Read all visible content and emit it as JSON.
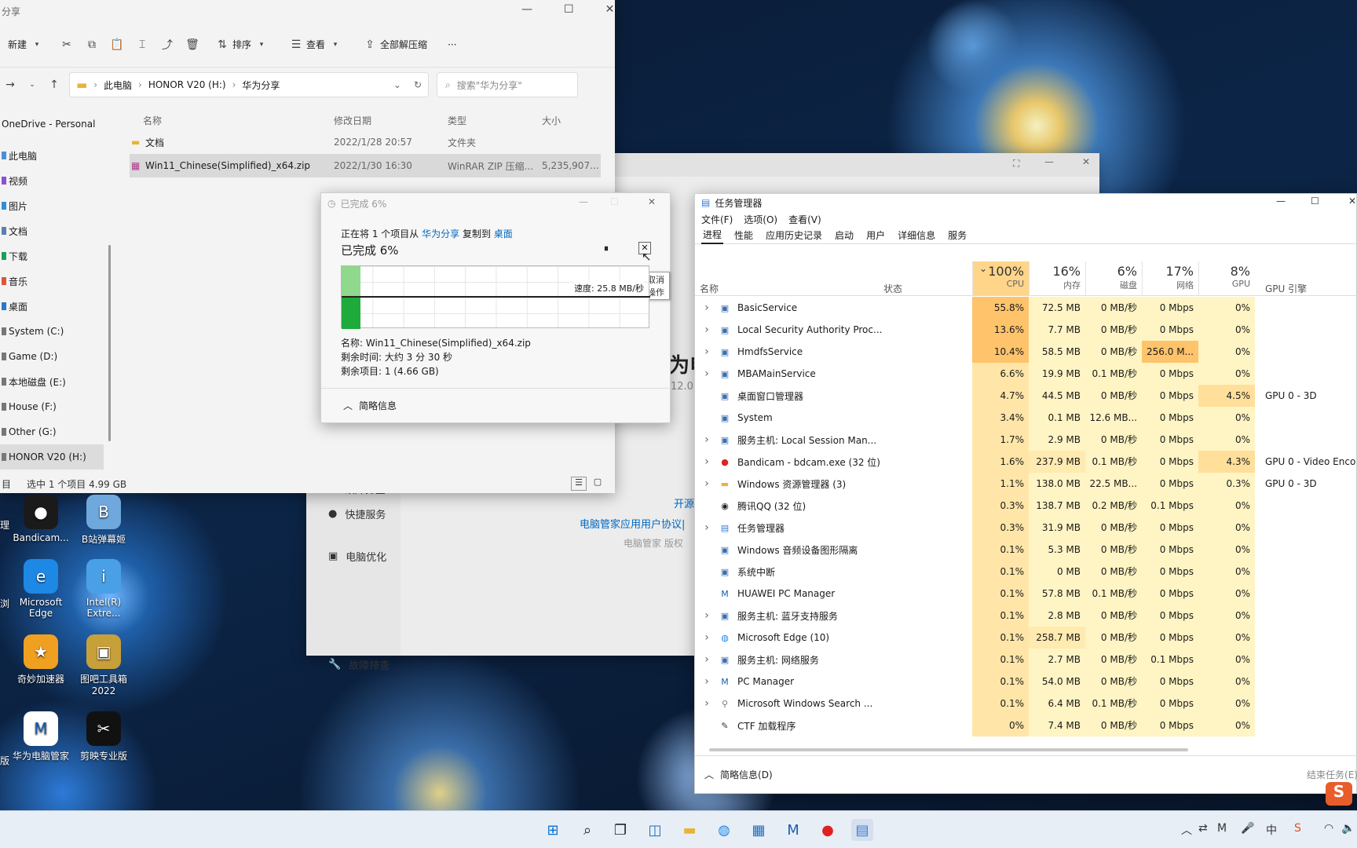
{
  "explorer": {
    "title": "分享",
    "toolbar": {
      "new": "新建",
      "sort": "排序",
      "view": "查看",
      "extract": "全部解压缩",
      "more": "···"
    },
    "address": {
      "parts": [
        "此电脑",
        "HONOR V20 (H:)",
        "华为分享"
      ]
    },
    "search_placeholder": "搜索\"华为分享\"",
    "nav": [
      {
        "label": "OneDrive - Personal",
        "color": "#1b6ec2"
      },
      {
        "label": "此电脑",
        "color": "#4a90d9"
      },
      {
        "label": "视频",
        "color": "#8a4fd6"
      },
      {
        "label": "图片",
        "color": "#2f8fd8"
      },
      {
        "label": "文档",
        "color": "#5a7fb0"
      },
      {
        "label": "下载",
        "color": "#1aa05a"
      },
      {
        "label": "音乐",
        "color": "#e0533a"
      },
      {
        "label": "桌面",
        "color": "#2a78d0"
      },
      {
        "label": "System (C:)",
        "color": "#777777"
      },
      {
        "label": "Game (D:)",
        "color": "#777777"
      },
      {
        "label": "本地磁盘 (E:)",
        "color": "#777777"
      },
      {
        "label": "House (F:)",
        "color": "#777777"
      },
      {
        "label": "Other (G:)",
        "color": "#777777"
      },
      {
        "label": "HONOR V20 (H:)",
        "color": "#777777"
      }
    ],
    "columns": {
      "name": "名称",
      "date": "修改日期",
      "type": "类型",
      "size": "大小"
    },
    "files": [
      {
        "name": "文档",
        "date": "2022/1/28 20:57",
        "type": "文件夹",
        "size": ""
      },
      {
        "name": "Win11_Chinese(Simplified)_x64.zip",
        "date": "2022/1/30 16:30",
        "type": "WinRAR ZIP 压缩...",
        "size": "5,235,907..."
      }
    ],
    "status": {
      "count": "目",
      "selected": "选中 1 个项目  4.99 GB"
    }
  },
  "copy": {
    "title": "已完成 6%",
    "prefix": "正在将 1 个项目从",
    "src": "华为分享",
    "mid": "复制到",
    "dst": "桌面",
    "heading": "已完成 6%",
    "speed": "速度: 25.8 MB/秒",
    "tooltip": "取消操作",
    "name": "名称: Win11_Chinese(Simplified)_x64.zip",
    "remaining_time": "剩余时间: 大约 3 分 30 秒",
    "remaining_items": "剩余项目: 1 (4.66 GB)",
    "less": "简略信息",
    "progress": 0.06
  },
  "bgapp": {
    "title_partial": "为电",
    "version_partial": "12.0.",
    "menu": [
      "故障排查",
      "快捷服务",
      "电脑优化"
    ],
    "link1": "开源",
    "link2": "电脑管家应用用户协议|",
    "copyright": "电脑管家 版权"
  },
  "taskmgr": {
    "title": "任务管理器",
    "menu": [
      "文件(F)",
      "选项(O)",
      "查看(V)"
    ],
    "tabs": [
      "进程",
      "性能",
      "应用历史记录",
      "启动",
      "用户",
      "详细信息",
      "服务"
    ],
    "col_name": "名称",
    "col_status": "状态",
    "metrics": [
      {
        "pct": "100%",
        "label": "CPU"
      },
      {
        "pct": "16%",
        "label": "内存"
      },
      {
        "pct": "6%",
        "label": "磁盘"
      },
      {
        "pct": "17%",
        "label": "网络"
      },
      {
        "pct": "8%",
        "label": "GPU"
      }
    ],
    "gpu_engine": "GPU 引擎",
    "processes": [
      {
        "name": "BasicService",
        "cpu": "55.8%",
        "mem": "72.5 MB",
        "disk": "0 MB/秒",
        "net": "0 Mbps",
        "gpu": "0%",
        "eng": "",
        "exp": true
      },
      {
        "name": "Local Security Authority Proc...",
        "cpu": "13.6%",
        "mem": "7.7 MB",
        "disk": "0 MB/秒",
        "net": "0 Mbps",
        "gpu": "0%",
        "eng": "",
        "exp": true
      },
      {
        "name": "HmdfsService",
        "cpu": "10.4%",
        "mem": "58.5 MB",
        "disk": "0 MB/秒",
        "net": "256.0 M...",
        "gpu": "0%",
        "eng": "",
        "exp": true
      },
      {
        "name": "MBAMainService",
        "cpu": "6.6%",
        "mem": "19.9 MB",
        "disk": "0.1 MB/秒",
        "net": "0 Mbps",
        "gpu": "0%",
        "eng": "",
        "exp": true
      },
      {
        "name": "桌面窗口管理器",
        "cpu": "4.7%",
        "mem": "44.5 MB",
        "disk": "0 MB/秒",
        "net": "0 Mbps",
        "gpu": "4.5%",
        "eng": "GPU 0 - 3D",
        "exp": false
      },
      {
        "name": "System",
        "cpu": "3.4%",
        "mem": "0.1 MB",
        "disk": "12.6 MB...",
        "net": "0 Mbps",
        "gpu": "0%",
        "eng": "",
        "exp": false
      },
      {
        "name": "服务主机: Local Session Man...",
        "cpu": "1.7%",
        "mem": "2.9 MB",
        "disk": "0 MB/秒",
        "net": "0 Mbps",
        "gpu": "0%",
        "eng": "",
        "exp": true
      },
      {
        "name": "Bandicam - bdcam.exe (32 位)",
        "cpu": "1.6%",
        "mem": "237.9 MB",
        "disk": "0.1 MB/秒",
        "net": "0 Mbps",
        "gpu": "4.3%",
        "eng": "GPU 0 - Video Enco",
        "exp": true
      },
      {
        "name": "Windows 资源管理器 (3)",
        "cpu": "1.1%",
        "mem": "138.0 MB",
        "disk": "22.5 MB...",
        "net": "0 Mbps",
        "gpu": "0.3%",
        "eng": "GPU 0 - 3D",
        "exp": true
      },
      {
        "name": "腾讯QQ (32 位)",
        "cpu": "0.3%",
        "mem": "138.7 MB",
        "disk": "0.2 MB/秒",
        "net": "0.1 Mbps",
        "gpu": "0%",
        "eng": "",
        "exp": false
      },
      {
        "name": "任务管理器",
        "cpu": "0.3%",
        "mem": "31.9 MB",
        "disk": "0 MB/秒",
        "net": "0 Mbps",
        "gpu": "0%",
        "eng": "",
        "exp": true
      },
      {
        "name": "Windows 音频设备图形隔离",
        "cpu": "0.1%",
        "mem": "5.3 MB",
        "disk": "0 MB/秒",
        "net": "0 Mbps",
        "gpu": "0%",
        "eng": "",
        "exp": false
      },
      {
        "name": "系统中断",
        "cpu": "0.1%",
        "mem": "0 MB",
        "disk": "0 MB/秒",
        "net": "0 Mbps",
        "gpu": "0%",
        "eng": "",
        "exp": false
      },
      {
        "name": "HUAWEI PC Manager",
        "cpu": "0.1%",
        "mem": "57.8 MB",
        "disk": "0.1 MB/秒",
        "net": "0 Mbps",
        "gpu": "0%",
        "eng": "",
        "exp": false
      },
      {
        "name": "服务主机: 蓝牙支持服务",
        "cpu": "0.1%",
        "mem": "2.8 MB",
        "disk": "0 MB/秒",
        "net": "0 Mbps",
        "gpu": "0%",
        "eng": "",
        "exp": true
      },
      {
        "name": "Microsoft Edge (10)",
        "cpu": "0.1%",
        "mem": "258.7 MB",
        "disk": "0 MB/秒",
        "net": "0 Mbps",
        "gpu": "0%",
        "eng": "",
        "exp": true
      },
      {
        "name": "服务主机: 网络服务",
        "cpu": "0.1%",
        "mem": "2.7 MB",
        "disk": "0 MB/秒",
        "net": "0.1 Mbps",
        "gpu": "0%",
        "eng": "",
        "exp": true
      },
      {
        "name": "PC Manager",
        "cpu": "0.1%",
        "mem": "54.0 MB",
        "disk": "0 MB/秒",
        "net": "0 Mbps",
        "gpu": "0%",
        "eng": "",
        "exp": true
      },
      {
        "name": "Microsoft Windows Search ...",
        "cpu": "0.1%",
        "mem": "6.4 MB",
        "disk": "0.1 MB/秒",
        "net": "0 Mbps",
        "gpu": "0%",
        "eng": "",
        "exp": true
      },
      {
        "name": "CTF 加载程序",
        "cpu": "0%",
        "mem": "7.4 MB",
        "disk": "0 MB/秒",
        "net": "0 Mbps",
        "gpu": "0%",
        "eng": "",
        "exp": false
      }
    ],
    "footer_less": "简略信息(D)",
    "end_task": "结束任务(E)"
  },
  "desktop": [
    {
      "label": "Bandicam...",
      "color": "#1a1a1a",
      "glyph": "●"
    },
    {
      "label": "B站弹幕姬",
      "color": "#6fa8dc",
      "glyph": "B"
    },
    {
      "label": "Microsoft Edge",
      "color": "#1e88e5",
      "glyph": "e"
    },
    {
      "label": "Intel(R) Extre...",
      "color": "#4aa0e6",
      "glyph": "i"
    },
    {
      "label": "奇妙加速器",
      "color": "#f0a020",
      "glyph": "★"
    },
    {
      "label": "图吧工具箱 2022",
      "color": "#c8a03a",
      "glyph": "▣"
    },
    {
      "label": "华为电脑管家",
      "color": "#ffffff",
      "glyph": "M"
    },
    {
      "label": "剪映专业版",
      "color": "#111111",
      "glyph": "✂"
    }
  ],
  "desktop_left_partial": [
    "理",
    "浏",
    "版"
  ],
  "colors": {
    "cpu_hot": "#ffc36b",
    "cpu_cell": "#ffe6a8",
    "cell": "#fff4c4",
    "accent": "#0067c0",
    "progress": "#1faa3c"
  }
}
